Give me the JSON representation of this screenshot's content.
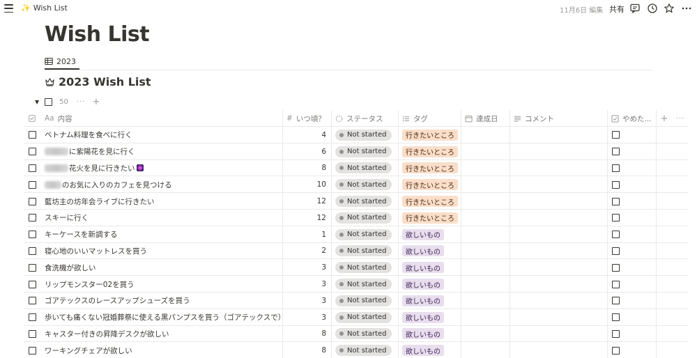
{
  "topbar": {
    "menu_icon": "hamburger-menu-icon",
    "breadcrumb_emoji": "✨",
    "breadcrumb_title": "Wish List",
    "edited": "11月6日 編集",
    "share_label": "共有",
    "icons": [
      "comment-icon",
      "history-clock-icon",
      "star-icon",
      "more-dots-icon"
    ]
  },
  "page": {
    "title": "Wish List"
  },
  "view": {
    "tab_icon": "table-icon",
    "tab_label": "2023"
  },
  "database": {
    "icon": "crown-icon",
    "title": "2023 Wish List"
  },
  "group": {
    "count": "50",
    "more": "···",
    "add": "+"
  },
  "columns": {
    "name": {
      "icon": "Aa",
      "label": "内容"
    },
    "when": {
      "icon": "#",
      "label": "いつ頃？"
    },
    "status": {
      "icon": "status-icon",
      "label": "ステータス"
    },
    "tag": {
      "icon": "list-icon",
      "label": "タグ"
    },
    "date": {
      "icon": "calendar-icon",
      "label": "達成日"
    },
    "comment": {
      "icon": "text-lines-icon",
      "label": "コメント"
    },
    "quit": {
      "icon": "checkbox-icon",
      "label": "やめた..."
    },
    "add": "+",
    "more": "···"
  },
  "colors": {
    "tag_place_bg": "#fadec9",
    "tag_place_fg": "#49290e",
    "tag_want_bg": "#e8deee",
    "tag_want_fg": "#412454",
    "status_bg": "#e3e2e0"
  },
  "rows": [
    {
      "pre": "",
      "name": "ベトナム料理を食べに行く",
      "emoji": false,
      "when": "4",
      "status": "Not started",
      "tag": "行きたいところ",
      "tag_kind": "place"
    },
    {
      "pre": "blur",
      "name": "に紫陽花を見に行く",
      "emoji": false,
      "when": "6",
      "status": "Not started",
      "tag": "行きたいところ",
      "tag_kind": "place"
    },
    {
      "pre": "blur",
      "name": "花火を見に行きたい",
      "emoji": true,
      "when": "8",
      "status": "Not started",
      "tag": "行きたいところ",
      "tag_kind": "place"
    },
    {
      "pre": "blur",
      "name": "のお気に入りのカフェを見つける",
      "emoji": false,
      "when": "10",
      "status": "Not started",
      "tag": "行きたいところ",
      "tag_kind": "place"
    },
    {
      "pre": "",
      "name": "藍坊主の坊年会ライブに行きたい",
      "emoji": false,
      "when": "12",
      "status": "Not started",
      "tag": "行きたいところ",
      "tag_kind": "place"
    },
    {
      "pre": "",
      "name": "スキーに行く",
      "emoji": false,
      "when": "12",
      "status": "Not started",
      "tag": "行きたいところ",
      "tag_kind": "place"
    },
    {
      "pre": "",
      "name": "キーケースを新調する",
      "emoji": false,
      "when": "1",
      "status": "Not started",
      "tag": "欲しいもの",
      "tag_kind": "want"
    },
    {
      "pre": "",
      "name": "寝心地のいいマットレスを買う",
      "emoji": false,
      "when": "2",
      "status": "Not started",
      "tag": "欲しいもの",
      "tag_kind": "want"
    },
    {
      "pre": "",
      "name": "食洗機が欲しい",
      "emoji": false,
      "when": "3",
      "status": "Not started",
      "tag": "欲しいもの",
      "tag_kind": "want"
    },
    {
      "pre": "",
      "name": "リップモンスター02を買う",
      "emoji": false,
      "when": "3",
      "status": "Not started",
      "tag": "欲しいもの",
      "tag_kind": "want"
    },
    {
      "pre": "",
      "name": "ゴアテックスのレースアップシューズを買う",
      "emoji": false,
      "when": "3",
      "status": "Not started",
      "tag": "欲しいもの",
      "tag_kind": "want"
    },
    {
      "pre": "",
      "name": "歩いても痛くない冠婚葬祭に使える黒パンプスを買う（ゴアテックスで）",
      "emoji": false,
      "when": "3",
      "status": "Not started",
      "tag": "欲しいもの",
      "tag_kind": "want"
    },
    {
      "pre": "",
      "name": "キャスター付きの昇降デスクが欲しい",
      "emoji": false,
      "when": "8",
      "status": "Not started",
      "tag": "欲しいもの",
      "tag_kind": "want"
    },
    {
      "pre": "",
      "name": "ワーキングチェアが欲しい",
      "emoji": false,
      "when": "8",
      "status": "Not started",
      "tag": "欲しいもの",
      "tag_kind": "want"
    }
  ]
}
